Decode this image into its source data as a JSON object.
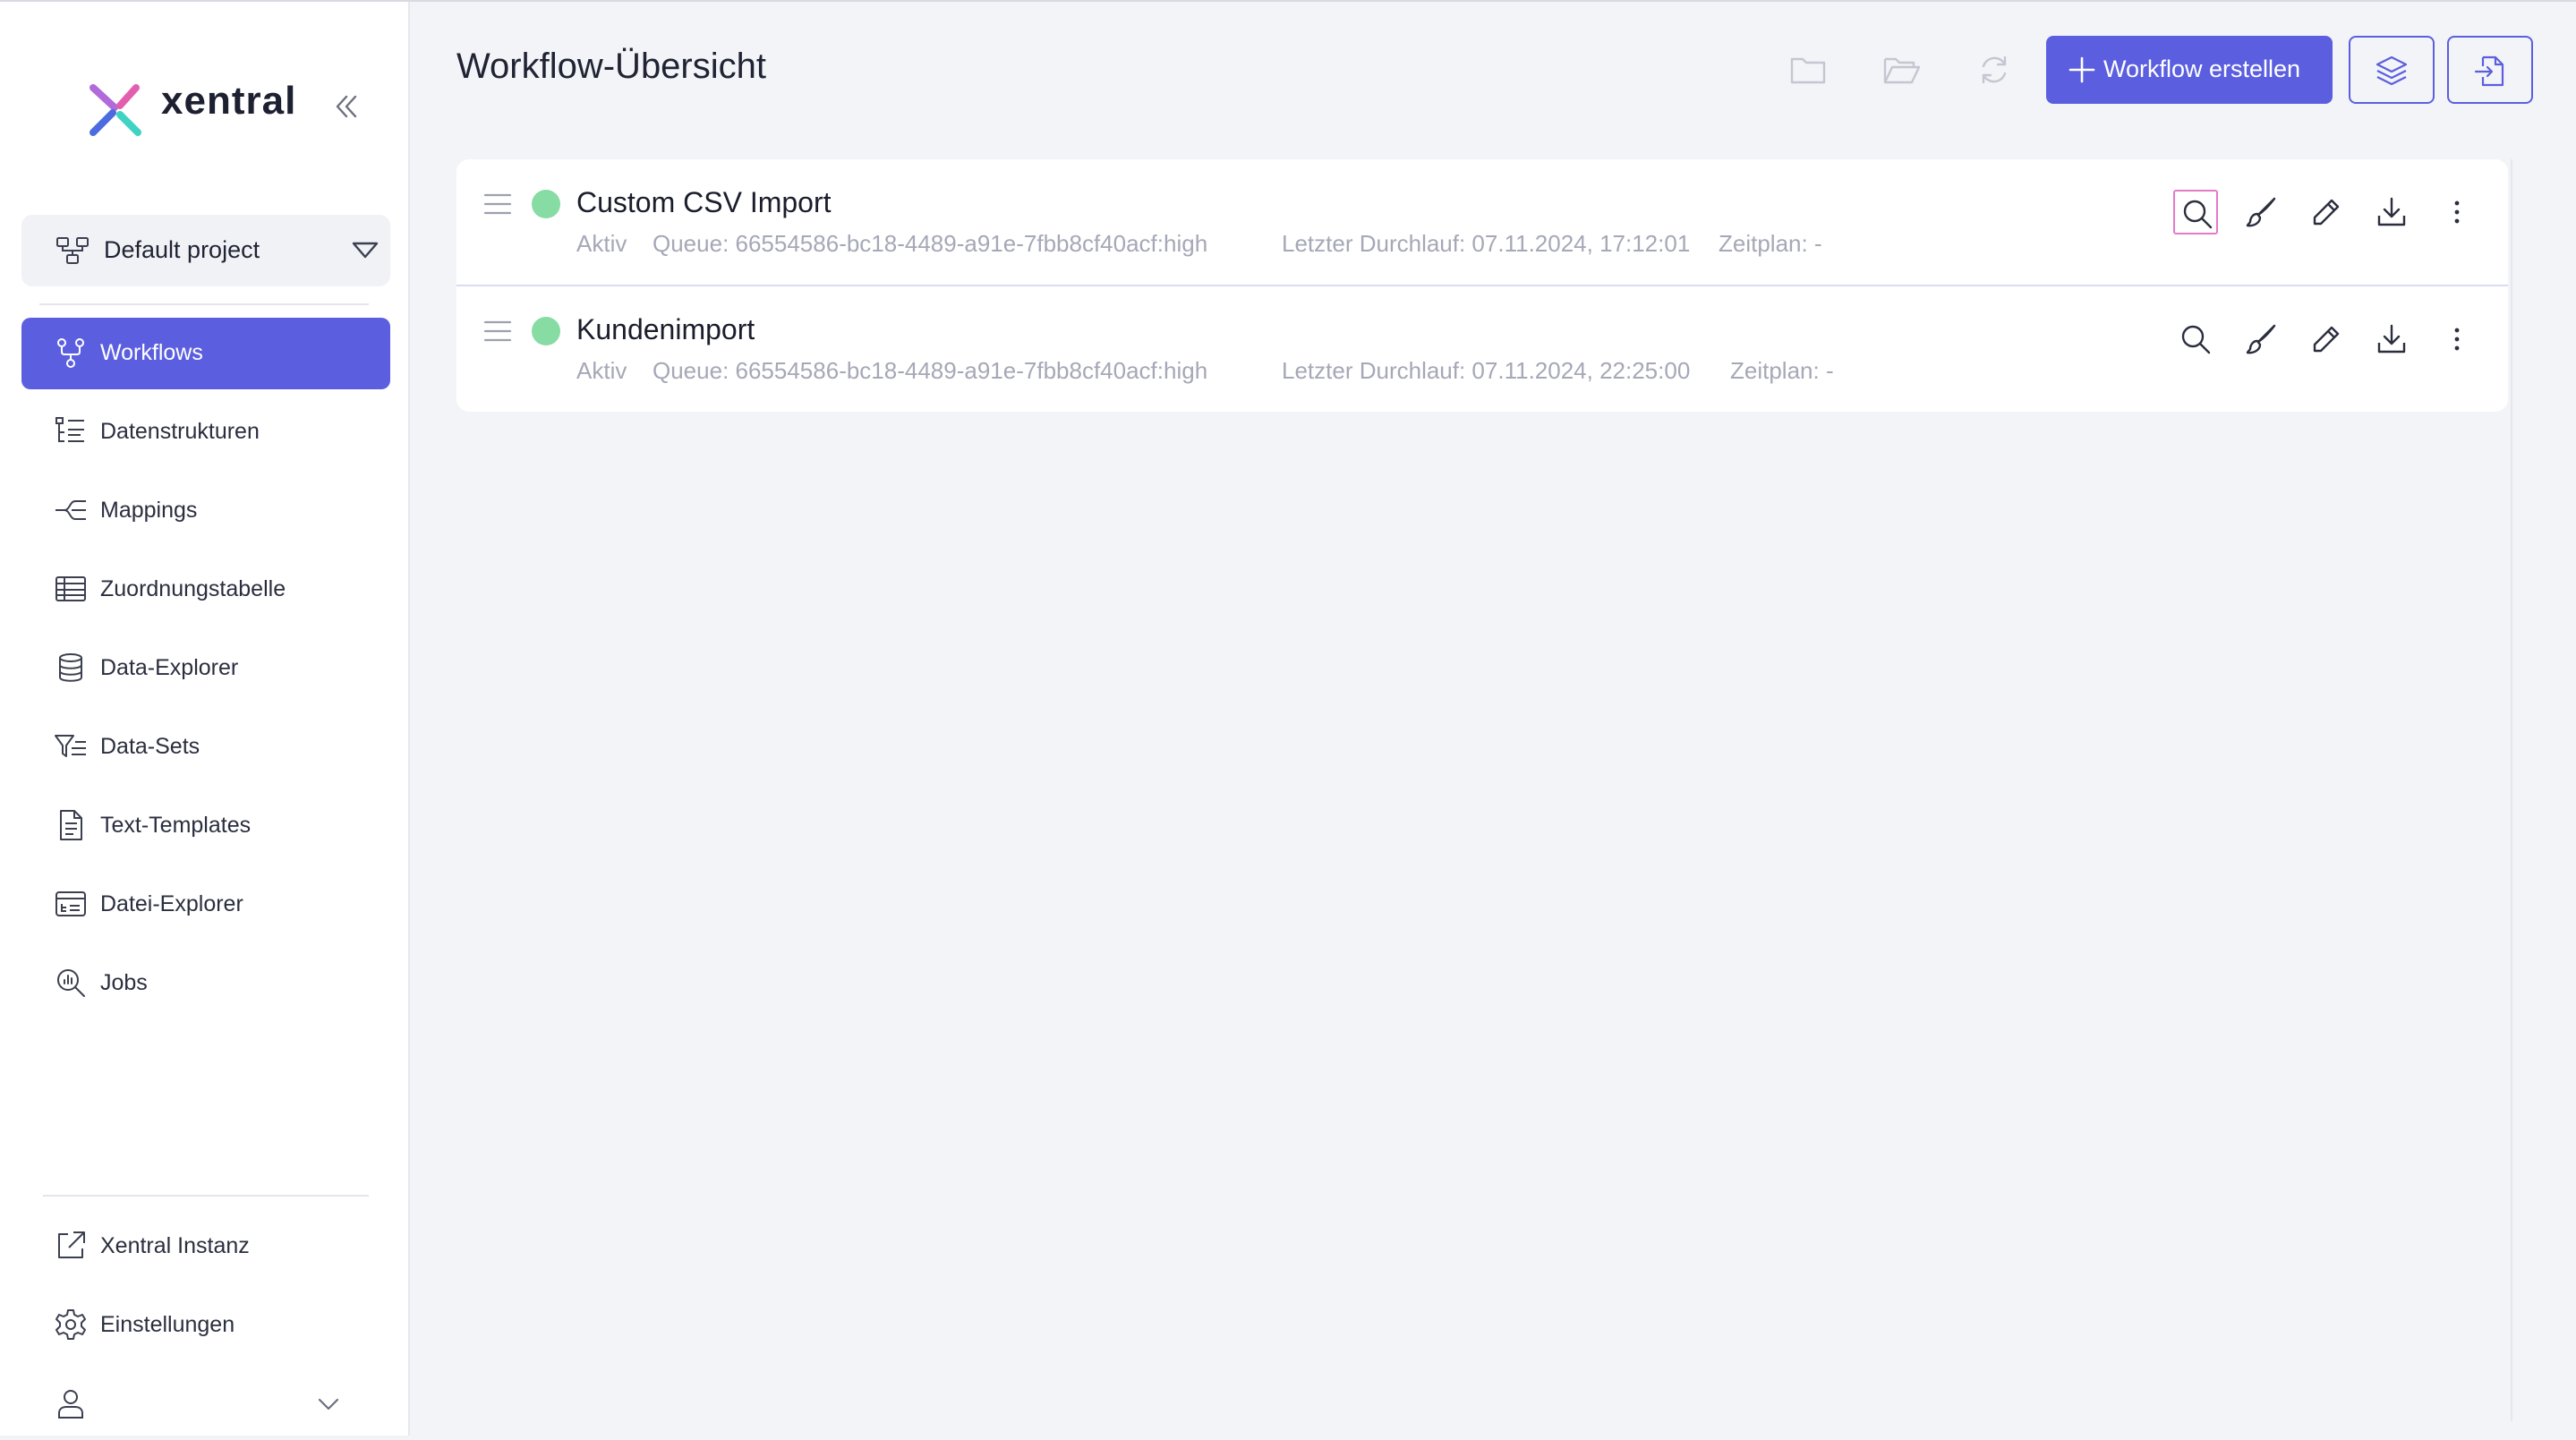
{
  "app": {
    "brand": "xentral"
  },
  "colors": {
    "accent": "#5b5fdf",
    "status_active": "#86dca3",
    "highlight": "#e57ac8"
  },
  "sidebar": {
    "project": {
      "label": "Default project"
    },
    "items": [
      {
        "label": "Workflows",
        "icon": "workflow-icon",
        "active": true
      },
      {
        "label": "Datenstrukturen",
        "icon": "data-structure-icon"
      },
      {
        "label": "Mappings",
        "icon": "mapping-icon"
      },
      {
        "label": "Zuordnungstabelle",
        "icon": "table-icon"
      },
      {
        "label": "Data-Explorer",
        "icon": "database-icon"
      },
      {
        "label": "Data-Sets",
        "icon": "filter-list-icon"
      },
      {
        "label": "Text-Templates",
        "icon": "document-icon"
      },
      {
        "label": "Datei-Explorer",
        "icon": "file-explorer-icon"
      },
      {
        "label": "Jobs",
        "icon": "jobs-search-icon"
      }
    ],
    "bottom_items": [
      {
        "label": "Xentral Instanz",
        "icon": "external-link-icon"
      },
      {
        "label": "Einstellungen",
        "icon": "gear-icon"
      }
    ]
  },
  "header": {
    "title": "Workflow-Übersicht",
    "create_label": "Workflow erstellen"
  },
  "workflows": [
    {
      "name": "Custom CSV Import",
      "status": "Aktiv",
      "queue": "Queue: 66554586-bc18-4489-a91e-7fbb8cf40acf:high",
      "last_run": "Letzter Durchlauf: 07.11.2024, 17:12:01",
      "schedule": "Zeitplan: -"
    },
    {
      "name": "Kundenimport",
      "status": "Aktiv",
      "queue": "Queue: 66554586-bc18-4489-a91e-7fbb8cf40acf:high",
      "last_run": "Letzter Durchlauf: 07.11.2024, 22:25:00",
      "schedule": "Zeitplan: -"
    }
  ]
}
